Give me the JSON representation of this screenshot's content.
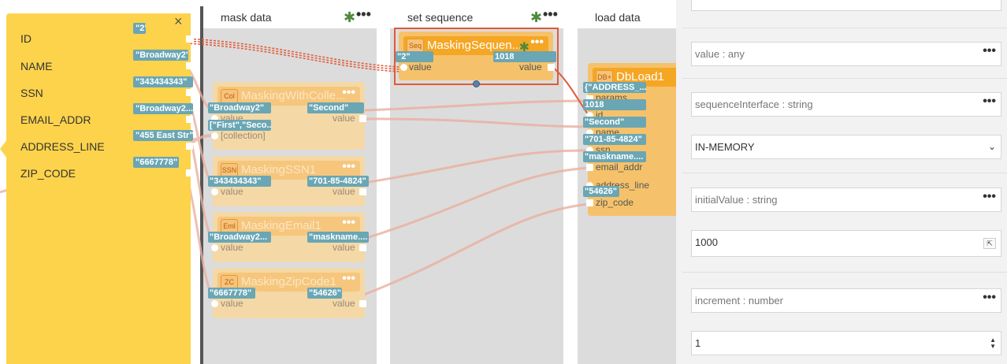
{
  "columns": {
    "mask": {
      "title": "mask data"
    },
    "sequence": {
      "title": "set sequence"
    },
    "load": {
      "title": "load data"
    }
  },
  "source": {
    "close_glyph": "×",
    "fields": [
      {
        "label": "ID",
        "value": "\"2\""
      },
      {
        "label": "NAME",
        "value": "\"Broadway2\""
      },
      {
        "label": "SSN",
        "value": "\"343434343\""
      },
      {
        "label": "EMAIL_ADDR",
        "value": "\"Broadway2..."
      },
      {
        "label": "ADDRESS_LINE",
        "value": "\"455 East Str\""
      },
      {
        "label": "ZIP_CODE",
        "value": "\"6667778\""
      }
    ]
  },
  "sequence_node": {
    "badge": "Seq",
    "title": "MaskingSequen...",
    "in_value": "\"2\"",
    "in_label": "value",
    "out_value": "1018",
    "out_label": "value"
  },
  "mask_nodes": [
    {
      "badge": "Col",
      "title": "MaskingWithColle...",
      "in_value": "\"Broadway2\"",
      "in_label": "value",
      "in2_value": "[\"First\",\"Seco...",
      "in2_label": "[collection]",
      "out_value": "\"Second\"",
      "out_label": "value"
    },
    {
      "badge": "SSN",
      "title": "MaskingSSN1",
      "in_value": "\"343434343\"",
      "in_label": "value",
      "out_value": "\"701-85-4824\"",
      "out_label": "value"
    },
    {
      "badge": "Eml",
      "title": "MaskingEmail1",
      "in_value": "\"Broadway2...",
      "in_label": "value",
      "out_value": "\"maskname....",
      "out_label": "value"
    },
    {
      "badge": "ZC",
      "title": "MaskingZipCode1",
      "in_value": "\"6667778\"",
      "in_label": "value",
      "out_value": "\"54626\"",
      "out_label": "value"
    }
  ],
  "load_node": {
    "badge": "DB+",
    "title": "DbLoad1",
    "ports": [
      {
        "label": "params",
        "value": "{\"ADDRESS_..."
      },
      {
        "label": "id",
        "value": "1018"
      },
      {
        "label": "name",
        "value": "\"Second\""
      },
      {
        "label": "ssn",
        "value": "\"701-85-4824\""
      },
      {
        "label": "email_addr",
        "value": "\"maskname...."
      },
      {
        "label": "address_line",
        "value": ""
      },
      {
        "label": "zip_code",
        "value": "\"54626\""
      }
    ]
  },
  "properties": {
    "value_label": "value : any",
    "sequence_interface_label": "sequenceInterface : string",
    "sequence_interface_value": "IN-MEMORY",
    "initial_value_label": "initialValue : string",
    "initial_value": "1000",
    "increment_label": "increment : number",
    "increment_value": "1",
    "more_glyph": "•••"
  },
  "colors": {
    "source_panel": "#fdd34b",
    "node_active": "#f5a623",
    "value_tag": "#6aa6b4",
    "selection_border": "#e05a3a",
    "star": "#4c8a3c"
  }
}
